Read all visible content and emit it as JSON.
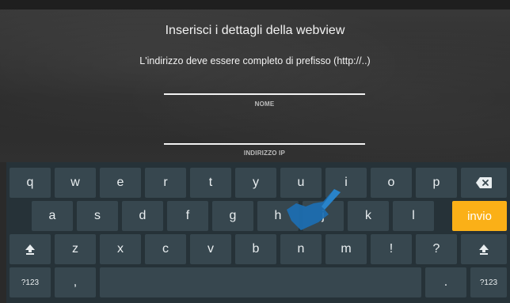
{
  "dialog": {
    "title": "Inserisci i dettagli della webview",
    "subtitle": "L'indirizzo deve essere completo di prefisso (http://..)",
    "fields": [
      {
        "label": "NOME",
        "value": ""
      },
      {
        "label": "INDIRIZZO IP",
        "value": ""
      }
    ]
  },
  "keyboard": {
    "row1": [
      "q",
      "w",
      "e",
      "r",
      "t",
      "y",
      "u",
      "i",
      "o",
      "p"
    ],
    "row2": [
      "a",
      "s",
      "d",
      "f",
      "g",
      "h",
      "j",
      "k",
      "l"
    ],
    "enter_label": "invio",
    "row3": [
      "z",
      "x",
      "c",
      "v",
      "b",
      "n",
      "m",
      "!",
      "?"
    ],
    "symbols_label": "?123",
    "comma_label": ",",
    "space_label": "",
    "period_label": ".",
    "icons": {
      "backspace": "backspace-icon",
      "shift": "shift-arrow-icon"
    },
    "accent_color": "#fbb017"
  }
}
